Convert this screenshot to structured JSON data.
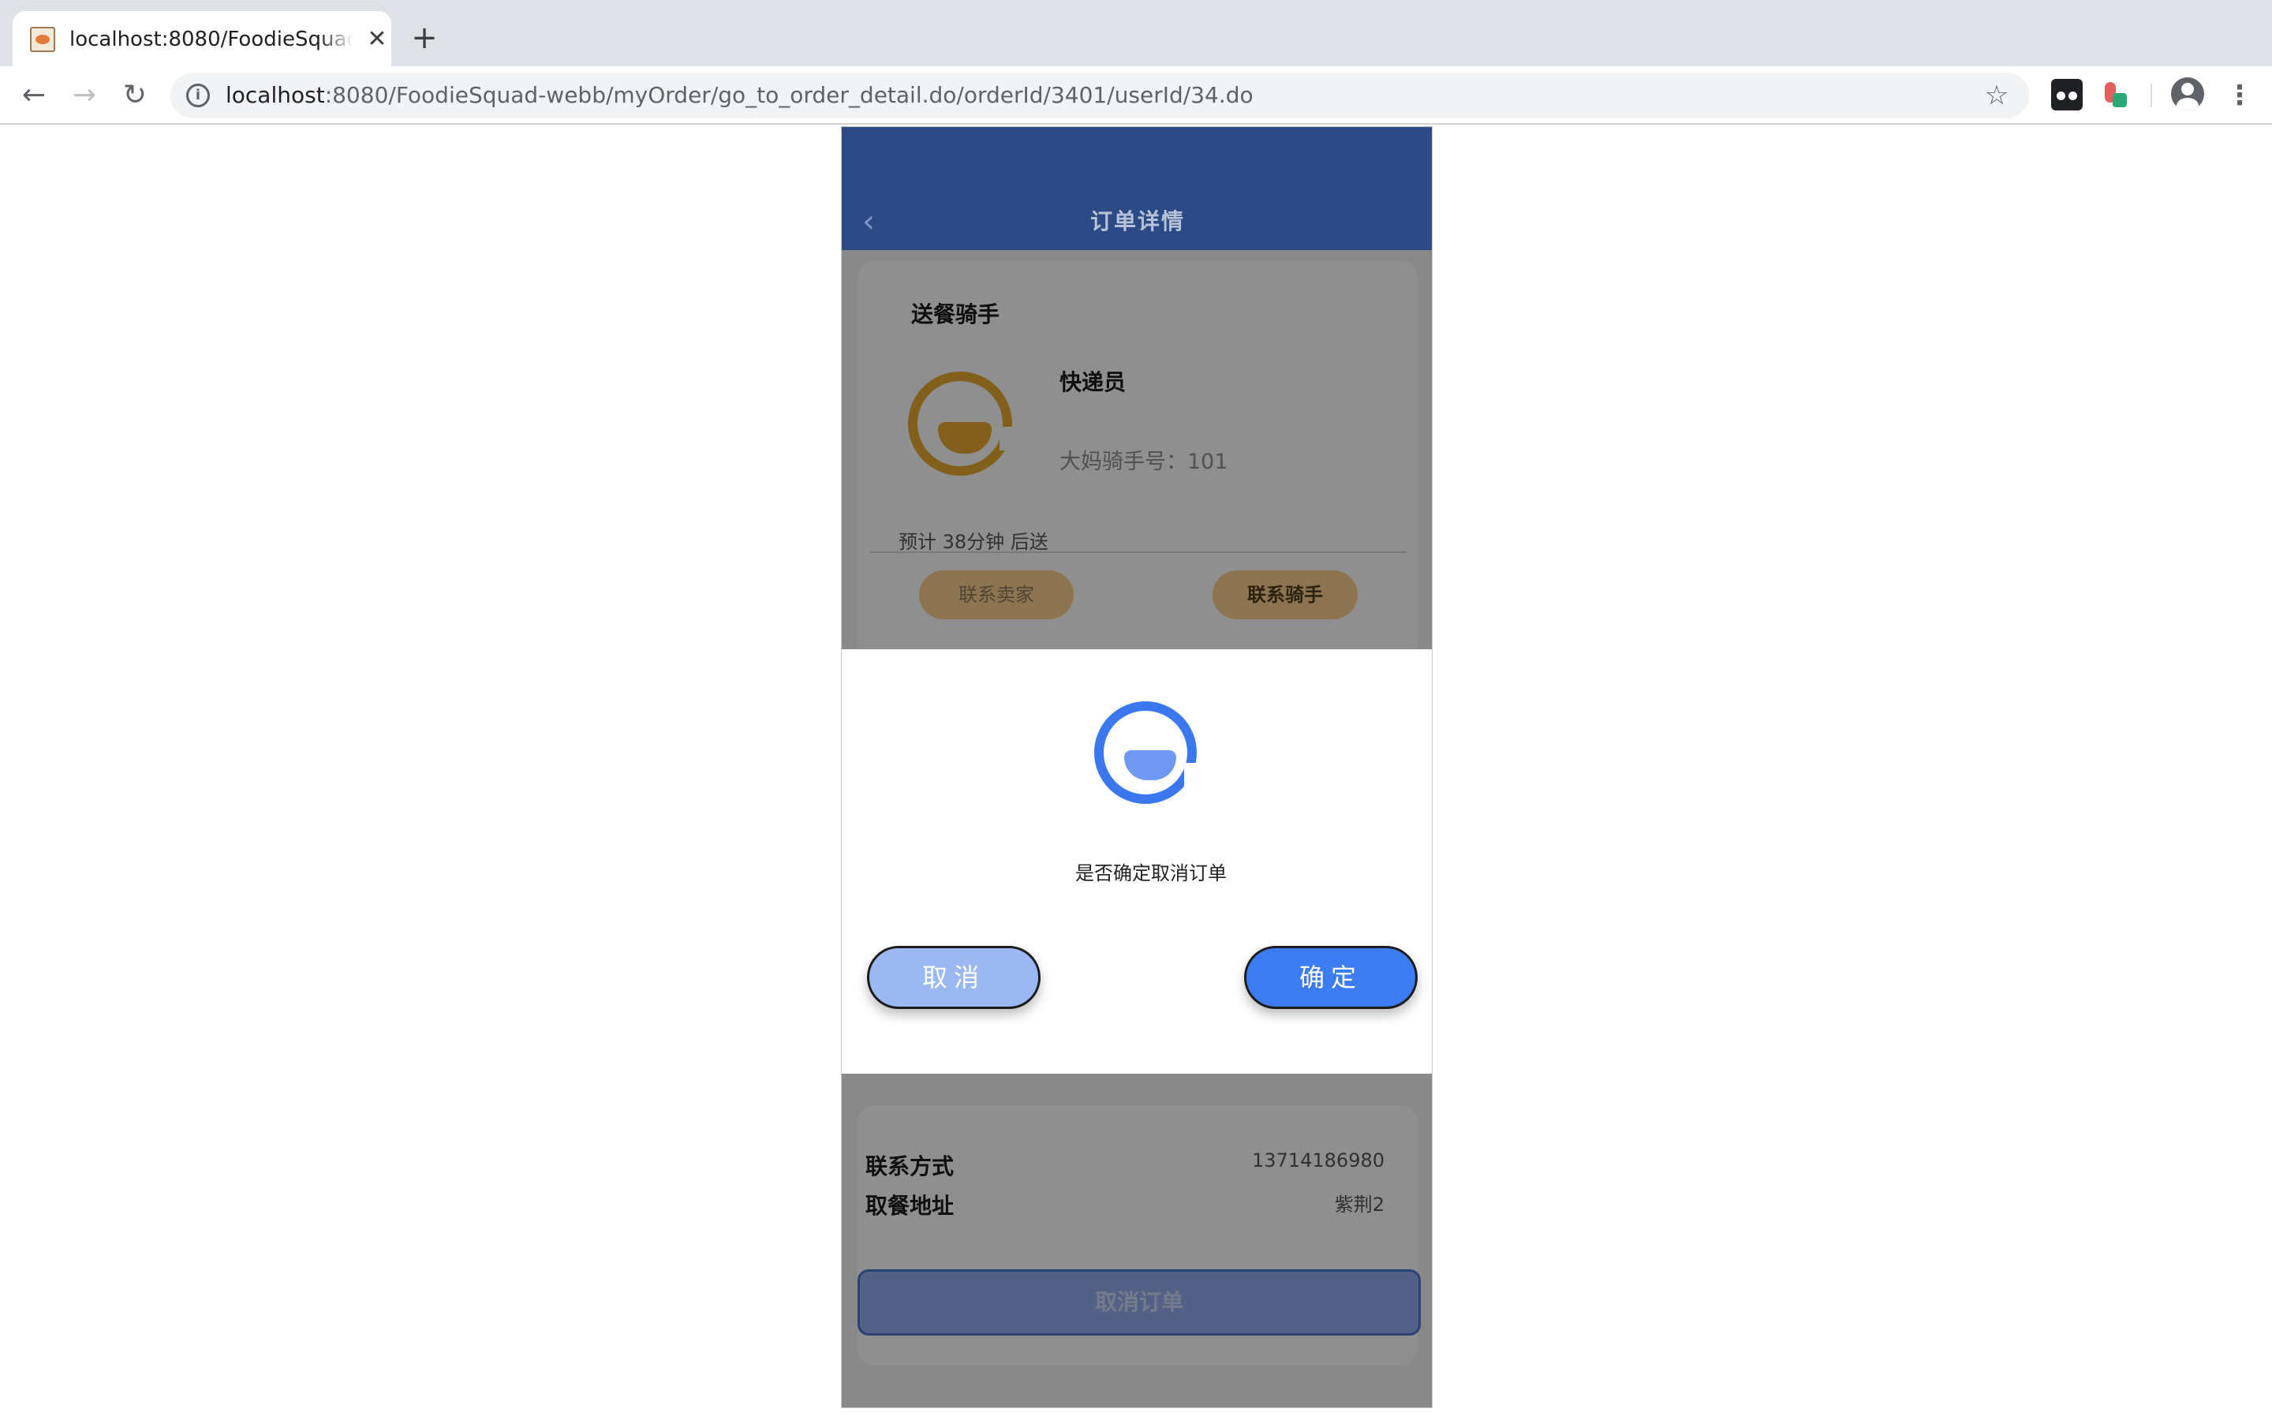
{
  "browser": {
    "tab_title": "localhost:8080/FoodieSquad-webb/myOrder/go_to_order_detail.do/orderId/3401/userId/34.do",
    "tab_close": "✕",
    "new_tab": "+",
    "url_host": "localhost",
    "url_rest": ":8080/FoodieSquad-webb/myOrder/go_to_order_detail.do/orderId/3401/userId/34.do",
    "back": "←",
    "forward": "→",
    "reload": "↻",
    "star": "☆",
    "menu": "⋮"
  },
  "app": {
    "header_title": "订单详情",
    "back_glyph": "‹"
  },
  "rider": {
    "section_title": "送餐骑手",
    "name": "快递员",
    "number": "大妈骑手号：101",
    "eta": "预计 38分钟 后送",
    "contact_seller": "联系卖家",
    "contact_rider": "联系骑手"
  },
  "contact": {
    "phone_label": "联系方式",
    "phone_value": "13714186980",
    "address_label": "取餐地址",
    "address_value": "紫荆2"
  },
  "cancel_order_button": "取消订单",
  "dialog": {
    "message": "是否确定取消订单",
    "cancel": "取消",
    "confirm": "确定"
  },
  "colors": {
    "header": "#2c4a86",
    "accent": "#3d7bf0",
    "rider_accent": "#e0a531"
  }
}
